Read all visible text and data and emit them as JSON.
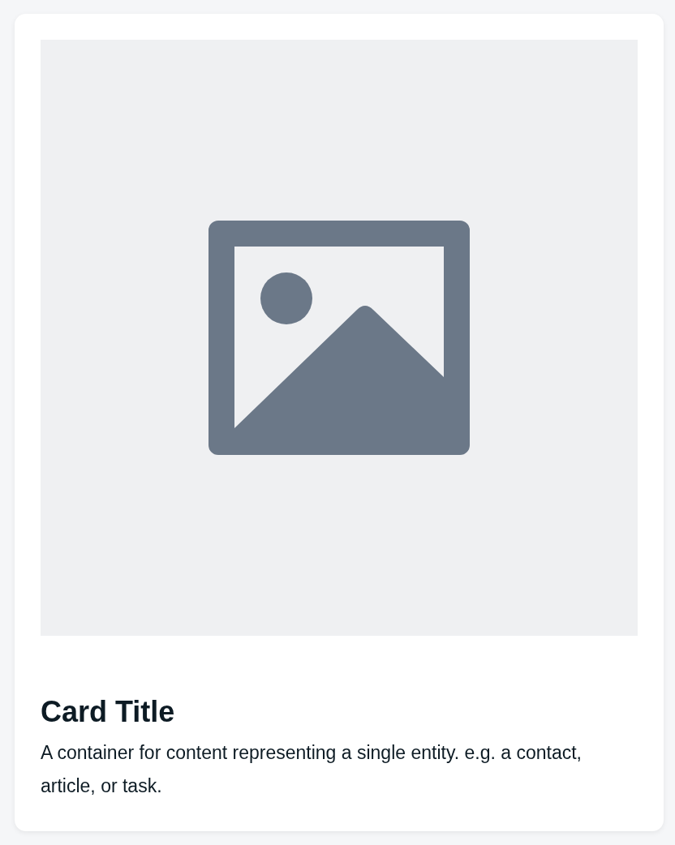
{
  "card": {
    "title": "Card Title",
    "description": "A container for content representing a single entity. e.g. a contact, article, or task."
  }
}
